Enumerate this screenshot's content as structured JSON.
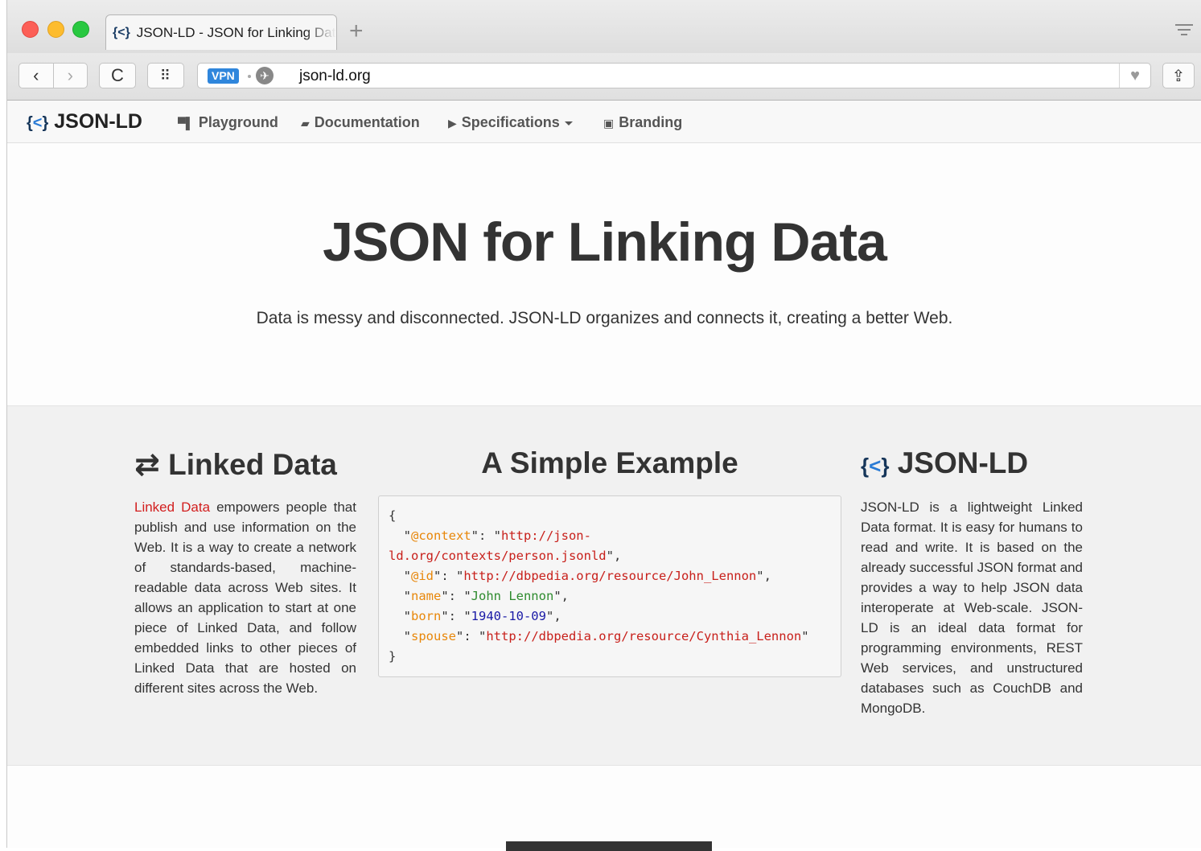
{
  "browser": {
    "tab_title": "JSON-LD - JSON for Linking Data",
    "tab_icon": "{<}",
    "new_tab_label": "+",
    "vpn_label": "VPN",
    "url": "json-ld.org",
    "back_icon": "‹",
    "forward_icon": "›",
    "reload_icon": "C",
    "speed_dial_icon": "⠿",
    "heart_icon": "♥",
    "share_icon": "⇪"
  },
  "site_nav": {
    "brand": "JSON-LD",
    "items": [
      {
        "label": "Playground",
        "icon": "playground-icon"
      },
      {
        "label": "Documentation",
        "icon": "book-icon"
      },
      {
        "label": "Specifications",
        "icon": "folder-open-icon"
      },
      {
        "label": "Branding",
        "icon": "picture-icon"
      }
    ]
  },
  "hero": {
    "title": "JSON for Linking Data",
    "lead": "Data is messy and disconnected. JSON-LD organizes and connects it, creating a better Web."
  },
  "features": {
    "linked_data": {
      "heading": "Linked Data",
      "link_text": "Linked Data",
      "body": " empowers people that publish and use information on the Web. It is a way to create a network of standards-based, machine-readable data across Web sites. It allows an application to start at one piece of Linked Data, and follow embedded links to other pieces of Linked Data that are hosted on different sites across the Web."
    },
    "example": {
      "heading": "A Simple Example",
      "open_brace": "{",
      "close_brace": "}",
      "context_key": "@context",
      "context_value_1": "http://json-",
      "context_value_2": "ld.org/contexts/person.jsonld",
      "id_key": "@id",
      "id_value": "http://dbpedia.org/resource/John_Lennon",
      "name_key": "name",
      "name_value": "John Lennon",
      "born_key": "born",
      "born_value": "1940-10-09",
      "spouse_key": "spouse",
      "spouse_value": "http://dbpedia.org/resource/Cynthia_Lennon"
    },
    "jsonld": {
      "heading": "JSON-LD",
      "body": "JSON-LD is a lightweight Linked Data format. It is easy for humans to read and write. It is based on the already successful JSON format and provides a way to help JSON data interoperate at Web-scale. JSON-LD is an ideal data format for programming environments, REST Web services, and unstructured databases such as CouchDB and MongoDB."
    }
  },
  "colors": {
    "link_red": "#d21e1e",
    "code_key_orange": "#e8870a",
    "code_string_red": "#c8201b",
    "code_name_green": "#2e8b2e",
    "code_date_blue": "#1a1aa6",
    "vpn_blue": "#2f86dc"
  }
}
